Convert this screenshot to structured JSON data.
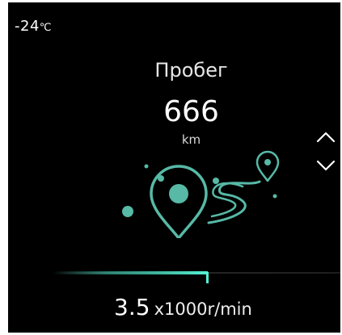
{
  "status": {
    "temperature_value": "-24",
    "temperature_unit": "℃"
  },
  "main": {
    "title": "Пробег",
    "value": "666",
    "unit": "km"
  },
  "controls": {
    "up_icon": "chevron-up-icon",
    "down_icon": "chevron-down-icon"
  },
  "illustration": {
    "icon": "map-route-icon"
  },
  "rpm": {
    "value": "3.5",
    "unit": "x1000r/min",
    "bar_fill_fraction": 0.54
  },
  "colors": {
    "background": "#000000",
    "accent": "#3fd0b4",
    "illustration": "#57b9a6",
    "text": "#ffffff"
  }
}
